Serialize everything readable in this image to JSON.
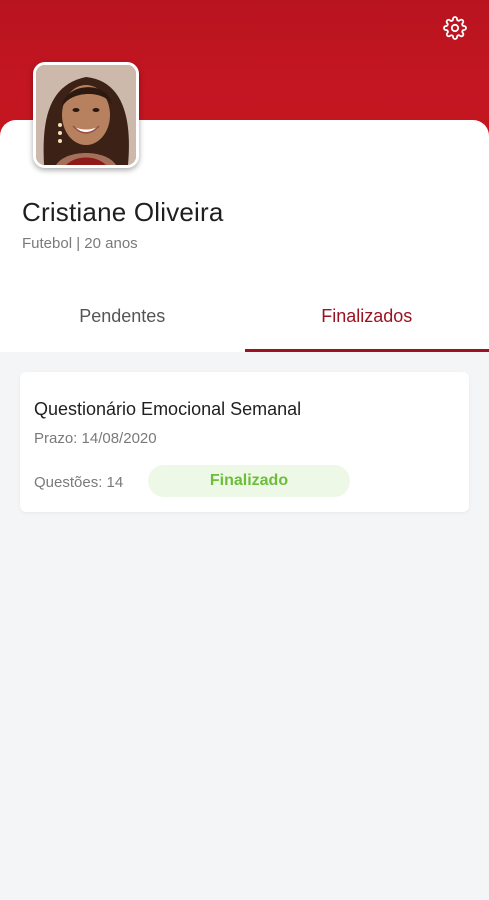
{
  "profile": {
    "name": "Cristiane Oliveira",
    "sport": "Futebol",
    "separator": "|",
    "age": "20 anos"
  },
  "tabs": [
    {
      "label": "Pendentes",
      "active": false
    },
    {
      "label": "Finalizados",
      "active": true
    }
  ],
  "quizzes": [
    {
      "title": "Questionário Emocional Semanal",
      "deadline": "Prazo: 14/08/2020",
      "questions": "Questões: 14",
      "status": "Finalizado"
    }
  ],
  "icons": {
    "settings": "gear-icon",
    "avatar": "profile-photo"
  },
  "colors": {
    "brand": "#c41622",
    "accent": "#9b1220",
    "status_done": "#6cbe3a",
    "status_done_bg": "#eef8e6"
  }
}
